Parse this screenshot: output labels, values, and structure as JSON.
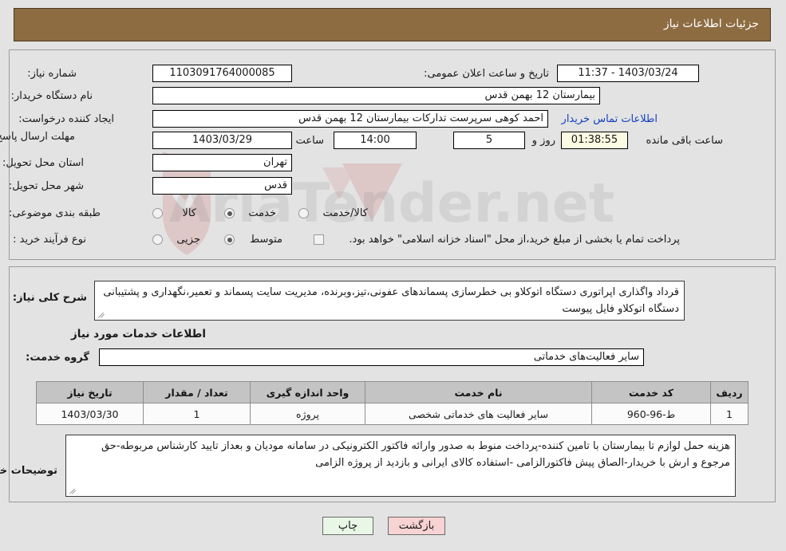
{
  "header": {
    "title": "جزئیات اطلاعات نیاز",
    "bar_color": "#8d6c42"
  },
  "need_info": {
    "need_number_label": "شماره نیاز:",
    "need_number_value": "1103091764000085",
    "announce_datetime_label": "تاریخ و ساعت اعلان عمومی:",
    "announce_datetime_value": "11:37 - 1403/03/24",
    "buyer_org_label": "نام دستگاه خریدار:",
    "buyer_org_value": "بیمارستان 12 بهمن قدس",
    "creator_label": "ایجاد کننده درخواست:",
    "creator_value": "احمد کوهی سرپرست تدارکات بیمارستان 12 بهمن قدس",
    "buyer_contact_link": "اطلاعات تماس خریدار",
    "deadline_label": "مهلت ارسال پاسخ: تا تاریخ:",
    "deadline_date_value": "1403/03/29",
    "hour_label": "ساعت",
    "deadline_time_value": "14:00",
    "days_value": "5",
    "days_label": "روز و",
    "countdown_value": "01:38:55",
    "countdown_label": "ساعت باقی مانده",
    "province_label": "استان محل تحویل:",
    "province_value": "تهران",
    "city_label": "شهر محل تحویل:",
    "city_value": "قدس",
    "category_label": "طبقه بندی موضوعی:",
    "category_options": [
      {
        "label": "کالا",
        "selected": false
      },
      {
        "label": "خدمت",
        "selected": true
      },
      {
        "label": "کالا/خدمت",
        "selected": false
      }
    ],
    "process_type_label": "نوع فرآیند خرید :",
    "process_type_options": [
      {
        "label": "جزیی",
        "selected": false
      },
      {
        "label": "متوسط",
        "selected": true
      }
    ],
    "treasury_checkbox_checked": false,
    "treasury_note": "پرداخت تمام یا بخشی از مبلغ خرید،از محل \"اسناد خزانه اسلامی\" خواهد بود."
  },
  "summary": {
    "label": "شرح کلی نیاز:",
    "value": "قرداد واگذاری اپراتوری دستگاه اتوکلاو بی خطرسازی پسماندهای عفونی،تیز،وبرنده، مدیریت سایت پسماند و تعمیر،نگهداری و پشتیبانی دستگاه اتوکلاو  فایل پیوست"
  },
  "services": {
    "section_title": "اطلاعات خدمات مورد نیاز",
    "group_label": "گروه خدمت:",
    "group_value": "سایر فعالیت‌های خدماتی",
    "table": {
      "headers": [
        "ردیف",
        "کد خدمت",
        "نام خدمت",
        "واحد اندازه گیری",
        "تعداد / مقدار",
        "تاریخ نیاز"
      ],
      "rows": [
        [
          "1",
          "ط-96-960",
          "سایر فعالیت های خدماتی شخصی",
          "پروژه",
          "1",
          "1403/03/30"
        ]
      ]
    }
  },
  "buyer_notes": {
    "label": "توضیحات خریدار:",
    "value": "هزینه حمل لوازم تا بیمارستان با تامین کننده-پرداخت منوط به صدور وارائه فاکتور الکترونیکی  در سامانه مودیان و  بعداز تایید کارشناس مربوطه-حق مرجوع و ارش با خریدار-الصاق پیش فاکتورالزامی -استفاده کالای ایرانی و بازدید از پروژه الزامی"
  },
  "footer": {
    "print_label": "چاپ",
    "back_label": "بازگشت"
  },
  "watermark": {
    "text": "AriaTender.net"
  }
}
